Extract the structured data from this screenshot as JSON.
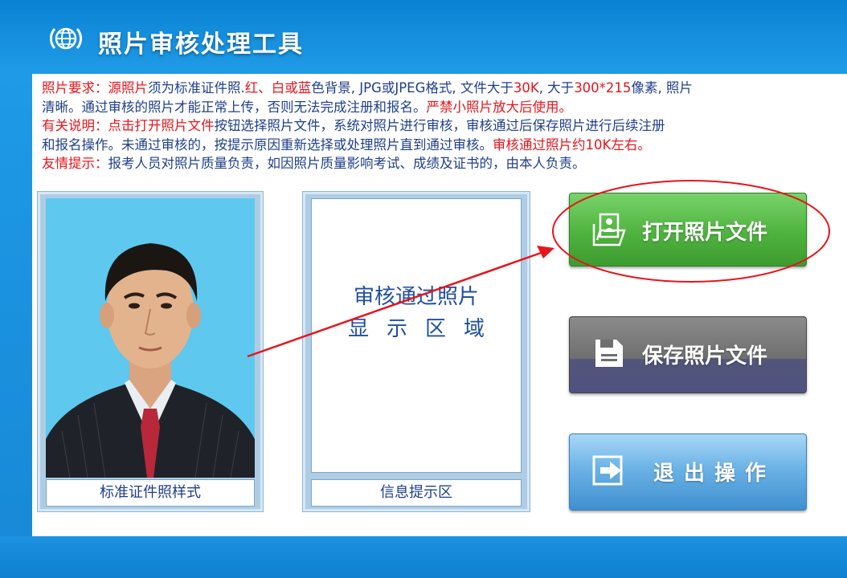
{
  "app": {
    "title": "照片审核处理工具"
  },
  "notice": {
    "line1": [
      {
        "t": "照片要求：源照片",
        "red": true
      },
      {
        "t": "须为标准证件照.",
        "red": false
      },
      {
        "t": "红、白或蓝",
        "red": true
      },
      {
        "t": "色背景, JPG或JPEG格式, 文件大于",
        "red": false
      },
      {
        "t": "30K",
        "red": true
      },
      {
        "t": ", 大于",
        "red": false
      },
      {
        "t": "300*215",
        "red": true
      },
      {
        "t": "像素, 照片",
        "red": false
      }
    ],
    "line2": [
      {
        "t": "清晰。通过审核的照片才能正常上传，否则无法完成注册和报名。",
        "red": false
      },
      {
        "t": "严禁小照片放大后使用。",
        "red": true
      }
    ],
    "line3": [
      {
        "t": "有关说明：点击",
        "red": true
      },
      {
        "t": "打开照片文件",
        "red": true
      },
      {
        "t": "按钮选择照片文件，系统对照片进行审核，审核通过后保存照片进行后续注册",
        "red": false
      }
    ],
    "line4": [
      {
        "t": "和报名操作。未通过审核的，按提示原因重新选择或处理照片直到通过审核。",
        "red": false
      },
      {
        "t": "审核通过照片约10K左右。",
        "red": true
      }
    ],
    "line5": [
      {
        "t": "友情提示：",
        "red": true
      },
      {
        "t": "报考人员对照片质量负责，如因照片质量影响考试、成绩及证书的，由本人负责。",
        "red": false
      }
    ]
  },
  "sample": {
    "caption": "标准证件照样式"
  },
  "review": {
    "display_line1": "审核通过照片",
    "display_line2": "显示区域",
    "caption": "信息提示区"
  },
  "buttons": {
    "open": "打开照片文件",
    "save": "保存照片文件",
    "exit": "退出操作"
  },
  "colors": {
    "accent_red": "#e8141b",
    "text_blue": "#1f3f8a",
    "open_green": "#4fb33f"
  }
}
